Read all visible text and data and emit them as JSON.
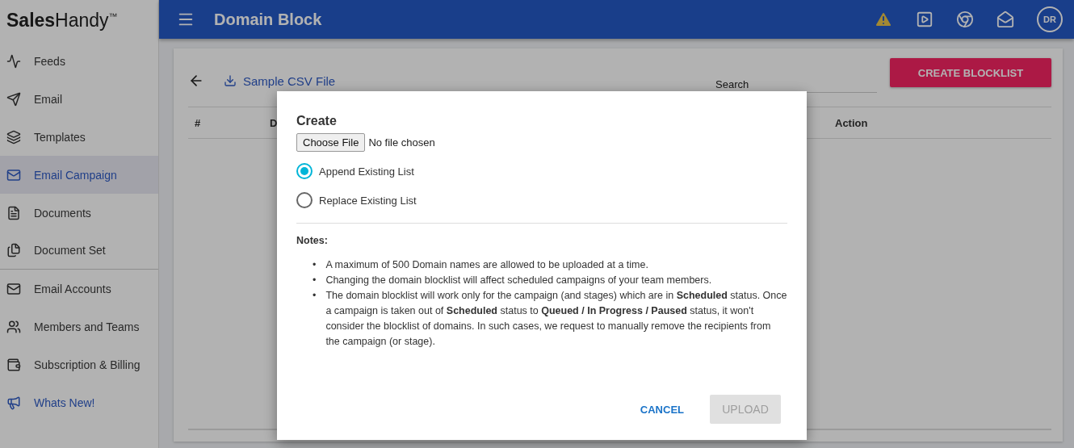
{
  "sidebar": {
    "logo": {
      "bold": "Sales",
      "light": "Handy",
      "mark": "™"
    },
    "items": [
      {
        "label": "Feeds",
        "selected": false,
        "highlight": false,
        "divider_after": false
      },
      {
        "label": "Email",
        "selected": false,
        "highlight": false,
        "divider_after": false
      },
      {
        "label": "Templates",
        "selected": false,
        "highlight": false,
        "divider_after": false
      },
      {
        "label": "Email Campaign",
        "selected": true,
        "highlight": false,
        "divider_after": false
      },
      {
        "label": "Documents",
        "selected": false,
        "highlight": false,
        "divider_after": false
      },
      {
        "label": "Document Set",
        "selected": false,
        "highlight": false,
        "divider_after": true
      },
      {
        "label": "Email Accounts",
        "selected": false,
        "highlight": false,
        "divider_after": false
      },
      {
        "label": "Members and Teams",
        "selected": false,
        "highlight": false,
        "divider_after": false
      },
      {
        "label": "Subscription & Billing",
        "selected": false,
        "highlight": false,
        "divider_after": false
      },
      {
        "label": "Whats New!",
        "selected": false,
        "highlight": true,
        "divider_after": false
      }
    ]
  },
  "header": {
    "title": "Domain Block",
    "avatar": "DR"
  },
  "toolbar": {
    "sample_link": "Sample CSV File",
    "search": {
      "placeholder": "Search"
    },
    "create_button": "CREATE BLOCKLIST"
  },
  "table": {
    "columns": [
      "#",
      "D",
      "Action"
    ]
  },
  "dialog": {
    "title": "Create",
    "file_button": "Choose File",
    "file_status": "No file chosen",
    "options": [
      {
        "label": "Append Existing List",
        "selected": true
      },
      {
        "label": "Replace Existing List",
        "selected": false
      }
    ],
    "notes_title": "Notes:",
    "notes": [
      {
        "bullet": "•",
        "text": "A maximum of 500 Domain names are allowed to be uploaded at a time."
      },
      {
        "bullet": "•",
        "text": "Changing the domain blocklist will affect scheduled campaigns of your team members."
      },
      {
        "bullet": "•",
        "text": "The domain blocklist will work only for the campaign (and stages) which are in **Scheduled** status. Once a campaign is taken out of **Scheduled** status to **Queued / In Progress / Paused** status, it won't consider the blocklist of domains. In such cases, we request to manually remove the recipients from the campaign (or stage)."
      }
    ],
    "cancel": "CANCEL",
    "upload": {
      "label": "UPLOAD",
      "disabled": true
    }
  }
}
